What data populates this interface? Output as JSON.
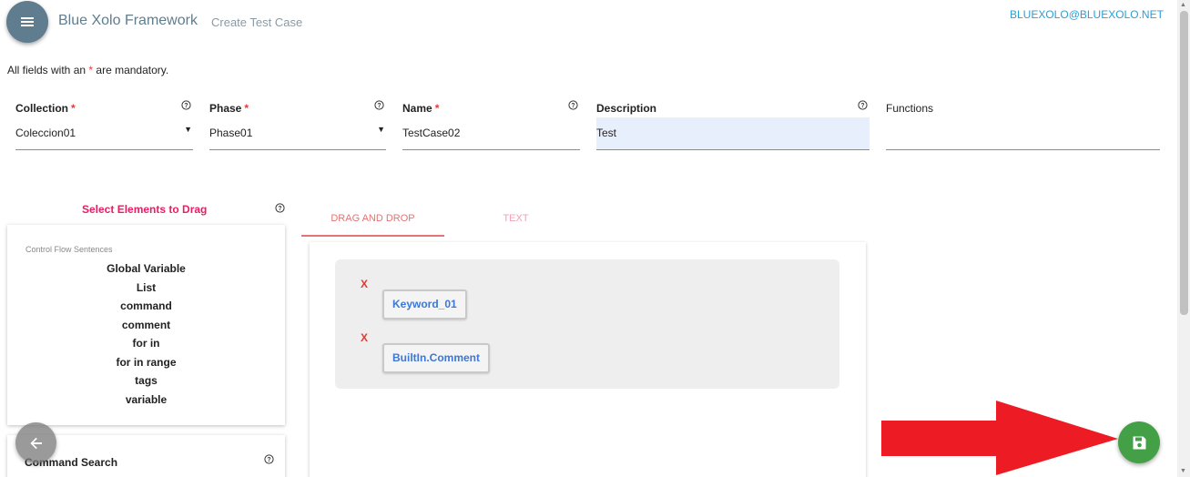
{
  "header": {
    "app_title": "Blue Xolo Framework",
    "page_subtitle": "Create Test Case",
    "user_email": "BLUEXOLO@BLUEXOLO.NET"
  },
  "form": {
    "mandatory_note_prefix": "All fields with an",
    "mandatory_note_star": "*",
    "mandatory_note_suffix": "are mandatory.",
    "collection": {
      "label": "Collection",
      "required": "*",
      "value": "Coleccion01"
    },
    "phase": {
      "label": "Phase",
      "required": "*",
      "value": "Phase01"
    },
    "name": {
      "label": "Name",
      "required": "*",
      "value": "TestCase02"
    },
    "description": {
      "label": "Description",
      "value": "Test"
    },
    "functions": {
      "label": "Functions",
      "value": ""
    }
  },
  "elements_panel": {
    "title": "Select Elements to Drag",
    "section_label": "Control Flow Sentences",
    "items": [
      "Global Variable",
      "List",
      "command",
      "comment",
      "for in",
      "for in range",
      "tags",
      "variable"
    ]
  },
  "command_search": {
    "title": "Command Search"
  },
  "tabs": [
    {
      "label": "DRAG AND DROP",
      "active": true
    },
    {
      "label": "TEXT",
      "active": false
    }
  ],
  "steps": [
    {
      "delete_label": "X",
      "keyword": "Keyword_01"
    },
    {
      "delete_label": "X",
      "keyword": "BuiltIn.Comment"
    }
  ],
  "colors": {
    "accent": "#5f7d8e",
    "email": "#2a9fd6",
    "required": "#e53935",
    "drag_title": "#e91e63",
    "keyword": "#3b78d8",
    "save": "#43a047",
    "arrow": "#ed1c24"
  },
  "icons": {
    "menu": "menu-icon",
    "help": "help-circle-icon",
    "back": "arrow-left-icon",
    "save": "floppy-disk-icon",
    "dropdown": "caret-down-icon"
  }
}
